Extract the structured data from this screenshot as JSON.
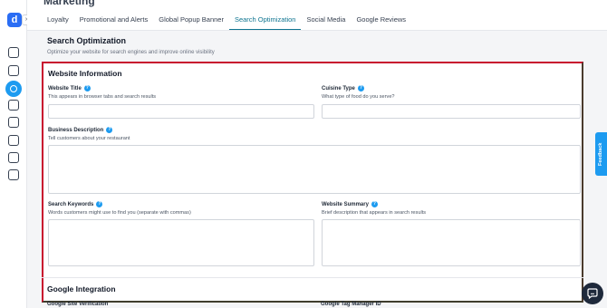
{
  "header": {
    "title": "Marketing"
  },
  "brand": {
    "letter": "d"
  },
  "tabs": [
    {
      "label": "Loyalty"
    },
    {
      "label": "Promotional and Alerts"
    },
    {
      "label": "Global Popup Banner"
    },
    {
      "label": "Search Optimization"
    },
    {
      "label": "Social Media"
    },
    {
      "label": "Google Reviews"
    }
  ],
  "section": {
    "title": "Search Optimization",
    "subtitle": "Optimize your website for search engines and improve online visibility"
  },
  "website_info": {
    "title": "Website Information",
    "website_title": {
      "label": "Website Title",
      "hint": "This appears in browser tabs and search results",
      "value": ""
    },
    "cuisine_type": {
      "label": "Cuisine Type",
      "hint": "What type of food do you serve?",
      "value": ""
    },
    "business_description": {
      "label": "Business Description",
      "hint": "Tell customers about your restaurant",
      "value": ""
    },
    "search_keywords": {
      "label": "Search Keywords",
      "hint": "Words customers might use to find you (separate with commas)",
      "value": ""
    },
    "website_summary": {
      "label": "Website Summary",
      "hint": "Brief description that appears in search results",
      "value": ""
    }
  },
  "google_integration": {
    "title": "Google Integration",
    "site_verification_label": "Google Site Verification",
    "tag_manager_label": "Google Tag Manager ID"
  },
  "feedback": {
    "label": "Feedback"
  },
  "colors": {
    "accent": "#1d9bf0",
    "active_tab": "#0e7490",
    "highlight_border": "#c8102e"
  }
}
